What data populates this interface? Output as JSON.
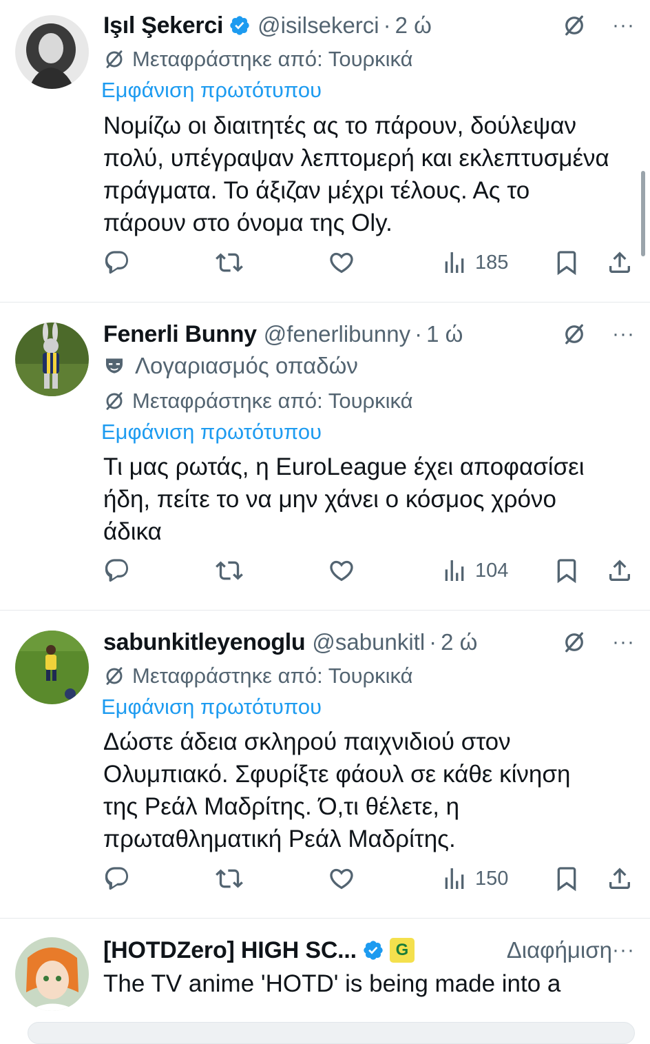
{
  "tweets": [
    {
      "name": "Işıl Şekerci",
      "verified": true,
      "handle": "@isilsekerci",
      "time": "2 ώ",
      "translated_label": "Μεταφράστηκε από: Τουρκικά",
      "show_original": "Εμφάνιση πρωτότυπου",
      "body_lines": [
        "Νομίζω οι διαιτητές ας το πάρουν, δούλεψαν",
        "πολύ, υπέγραψαν λεπτομερή και εκλεπτυσμένα",
        "πράγματα. Το άξιζαν μέχρι τέλους. Ας το",
        "πάρουν στο όνομα της Oly."
      ],
      "views": "185"
    },
    {
      "name": "Fenerli Bunny",
      "verified": false,
      "handle": "@fenerlibunny",
      "time": "1 ώ",
      "fan_label": "Λογαριασμός οπαδών",
      "translated_label": "Μεταφράστηκε από: Τουρκικά",
      "show_original": "Εμφάνιση πρωτότυπου",
      "body_lines": [
        "Τι μας ρωτάς, η EuroLeague έχει αποφασίσει",
        "ήδη, πείτε το να μην χάνει ο κόσμος χρόνο",
        "άδικα"
      ],
      "views": "104"
    },
    {
      "name": "sabunkitleyenoglu",
      "verified": false,
      "handle": "@sabunkitl",
      "time": "2 ώ",
      "translated_label": "Μεταφράστηκε από: Τουρκικά",
      "show_original": "Εμφάνιση πρωτότυπου",
      "body_lines": [
        "Δώστε άδεια σκληρού παιχνιδιού στον",
        "Ολυμπιακό. Σφυρίξτε φάουλ σε κάθε κίνηση",
        "της Ρεάλ Μαδρίτης. Ό,τι θέλετε, η",
        "πρωταθληματική Ρεάλ Μαδρίτης."
      ],
      "views": "150"
    }
  ],
  "ad": {
    "name": "[HOTDZero]  HIGH SC...",
    "verified": true,
    "badge_letter": "G",
    "label": "Διαφήμιση",
    "body_line": "The TV anime 'HOTD' is being made into a"
  },
  "separator": "·",
  "more_label": "···",
  "colors": {
    "accent": "#1d9bf0",
    "secondary_text": "#536471",
    "primary_text": "#0f1419",
    "grok_badge": "#f4e04d"
  }
}
